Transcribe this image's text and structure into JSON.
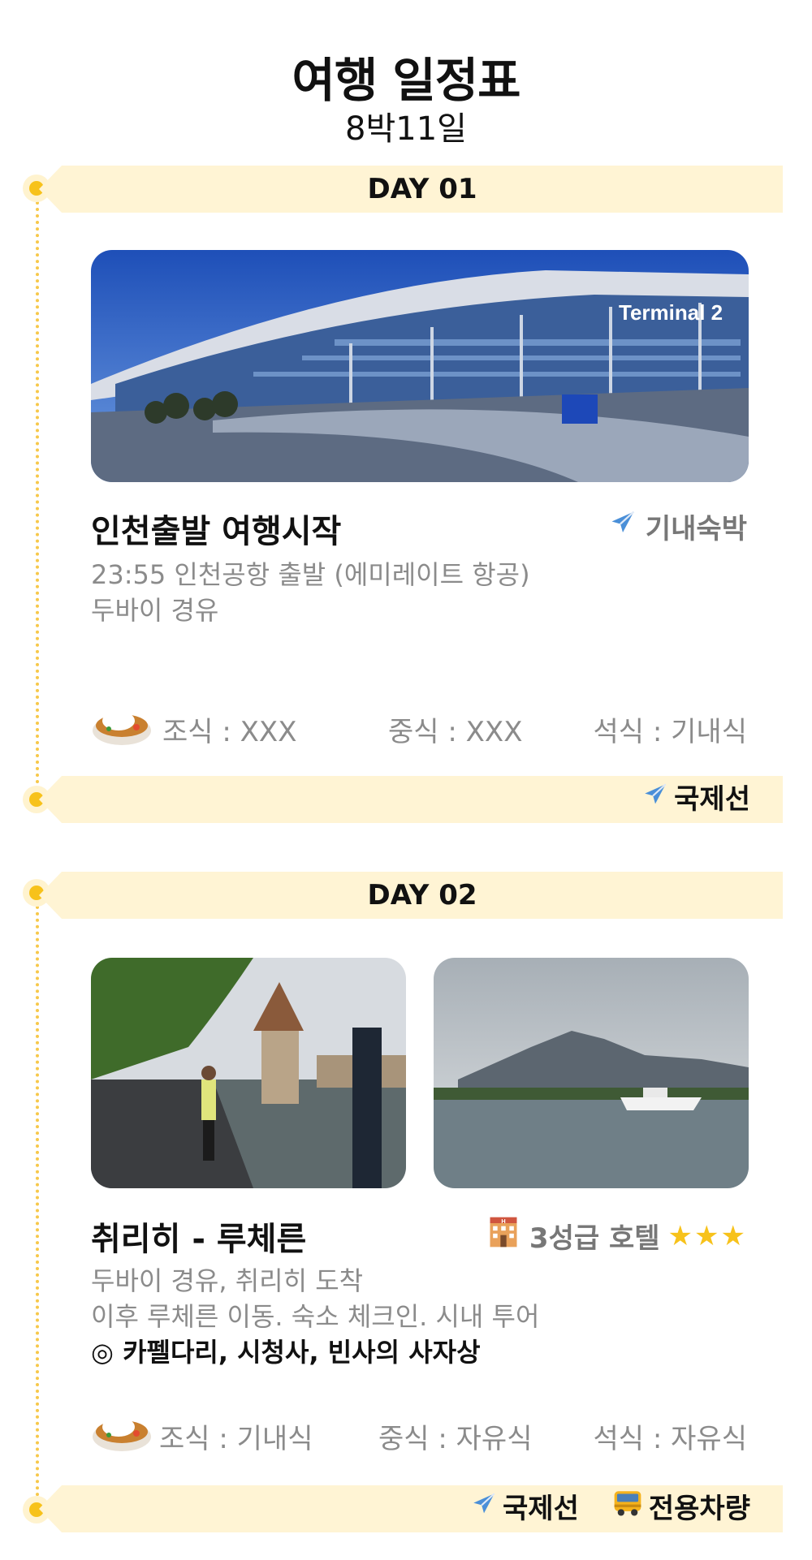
{
  "header": {
    "title": "여행 일정표",
    "subtitle": "8박11일"
  },
  "colors": {
    "accent": "#f7c21b",
    "banner": "#fff4d4",
    "muted": "#8b8b8b"
  },
  "days": [
    {
      "label": "DAY 01",
      "place": "인천출발 여행시작",
      "lodging": {
        "icon": "airplane-icon",
        "text": "기내숙박"
      },
      "description": [
        "23:55 인천공항 출발 (에미레이트 항공)",
        "두바이 경유"
      ],
      "meals": {
        "breakfast": "조식 : XXX",
        "lunch": "중식 : XXX",
        "dinner": "석식 : 기내식"
      },
      "transport": [
        {
          "icon": "airplane-icon",
          "text": "국제선"
        }
      ]
    },
    {
      "label": "DAY 02",
      "place": "취리히 - 루체른",
      "lodging": {
        "icon": "hotel-icon",
        "text": "3성급 호텔",
        "stars": "★★★"
      },
      "description": [
        "두바이 경유, 취리히 도착",
        "이후 루체른 이동. 숙소 체크인. 시내 투어"
      ],
      "highlight": "◎ 카펠다리, 시청사, 빈사의 사자상",
      "meals": {
        "breakfast": "조식 : 기내식",
        "lunch": "중식 : 자유식",
        "dinner": "석식 : 자유식"
      },
      "transport": [
        {
          "icon": "airplane-icon",
          "text": "국제선"
        },
        {
          "icon": "bus-icon",
          "text": "전용차량"
        }
      ]
    }
  ],
  "photos": {
    "day1": {
      "sign": "Terminal 2"
    }
  }
}
